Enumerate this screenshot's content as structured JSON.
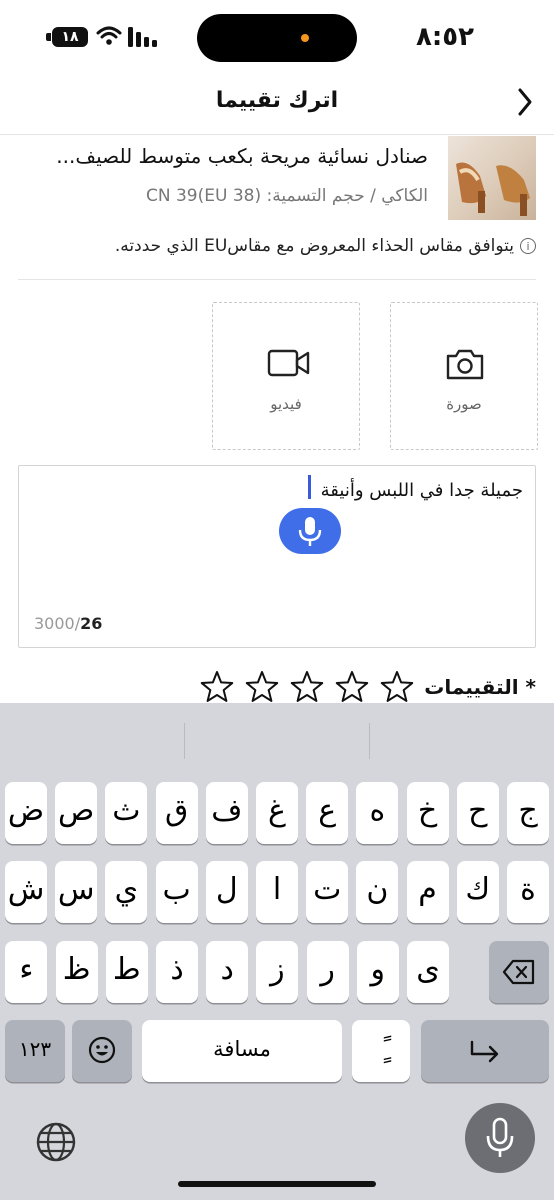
{
  "status_bar": {
    "time": "٨:٥٢",
    "battery": "١٨"
  },
  "header": {
    "title": "اترك تقييما"
  },
  "product": {
    "name": "صنادل نسائية مريحة بكعب متوسط للصيف...",
    "variant": "الكاكي / حجم التسمية: (38 CN 39(EU",
    "note": "يتوافق مقاس الحذاء المعروض مع مقاسEU  الذي حددته."
  },
  "upload": {
    "photo_label": "صورة",
    "video_label": "فيديو"
  },
  "review": {
    "text": "جميلة جدا في اللبس وأنيقة",
    "count": "26",
    "max": "3000/"
  },
  "rating": {
    "label": "* التقييمات",
    "stars": 0,
    "max_stars": 5
  },
  "keyboard": {
    "row1": [
      "ج",
      "ح",
      "خ",
      "ه",
      "ع",
      "غ",
      "ف",
      "ق",
      "ث",
      "ص",
      "ض"
    ],
    "row2": [
      "ة",
      "ك",
      "م",
      "ن",
      "ت",
      "ا",
      "ل",
      "ب",
      "ي",
      "س",
      "ش"
    ],
    "row3": [
      "ى",
      "و",
      "ر",
      "ز",
      "د",
      "ذ",
      "ط",
      "ظ",
      "ء"
    ],
    "numbers_key": "١٢٣",
    "space_label": "مسافة",
    "diacritic_key": "ًٍ",
    "return_icon": "return-icon",
    "delete_icon": "backspace-icon",
    "emoji_icon": "emoji-icon",
    "globe_icon": "globe-icon",
    "mic_icon": "microphone-icon"
  }
}
